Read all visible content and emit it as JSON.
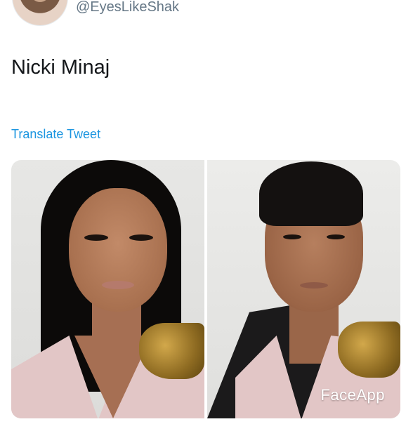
{
  "author": {
    "handle": "@EyesLikeShak",
    "avatar_icon": "profile-avatar"
  },
  "tweet": {
    "text": "Nicki Minaj",
    "translate_label": "Translate Tweet"
  },
  "media": {
    "photos": [
      {
        "alt": ""
      },
      {
        "alt": ""
      }
    ],
    "watermark": "FaceApp"
  },
  "colors": {
    "link": "#1b95e0",
    "secondary_text": "#657786",
    "primary_text": "#14171a"
  }
}
